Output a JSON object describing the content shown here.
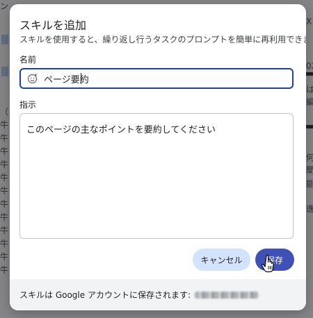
{
  "dialog": {
    "title": "スキルを追加",
    "subtitle": "スキルを使用すると、繰り返し行うタスクのプロンプトを簡単に再利用できます",
    "name_label": "名前",
    "name_value": "ページ要約",
    "instruction_label": "指示",
    "instruction_value": "このページの主なポイントを要約してください",
    "cancel_label": "キャンセル",
    "save_label": "保存",
    "footer_text": "スキルは Google アカウントに保存されます:"
  },
  "background": {
    "left_chars": [
      "ン",
      "",
      "",
      "",
      "",
      "",
      "",
      "",
      "（",
      "牛",
      "牛",
      "牛",
      "牛",
      "牛",
      "牛",
      "牛",
      "牛",
      "牛",
      "牛",
      "牛",
      "牛"
    ],
    "right_chars": [
      "X",
      "02",
      "は",
      "編",
      "何",
      "簡",
      "能",
      "逸"
    ]
  },
  "colors": {
    "accent": "#3f51b5",
    "cancel_bg": "#d3e3fd",
    "focus_border": "#1f3fa8"
  },
  "icons": {
    "name_field_icon": "add-emoji-icon",
    "cursor": "hand-pointer-icon"
  }
}
